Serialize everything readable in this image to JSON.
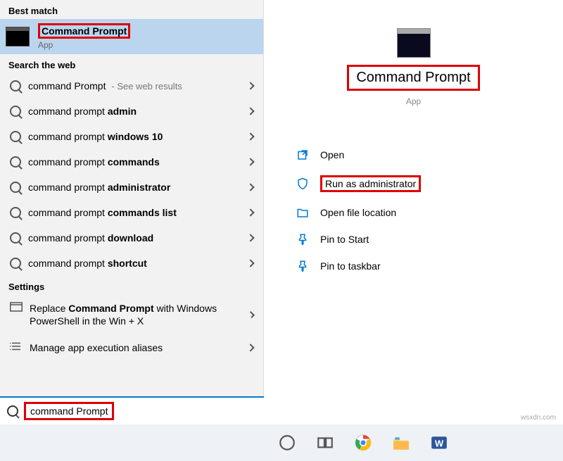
{
  "left": {
    "best_match_header": "Best match",
    "best_match": {
      "title": "Command Prompt",
      "subtitle": "App"
    },
    "web_header": "Search the web",
    "web_results": [
      {
        "prefix": "command Prompt",
        "bold": "",
        "hint": "- See web results"
      },
      {
        "prefix": "command prompt ",
        "bold": "admin",
        "hint": ""
      },
      {
        "prefix": "command prompt ",
        "bold": "windows 10",
        "hint": ""
      },
      {
        "prefix": "command prompt ",
        "bold": "commands",
        "hint": ""
      },
      {
        "prefix": "command prompt ",
        "bold": "administrator",
        "hint": ""
      },
      {
        "prefix": "command prompt ",
        "bold": "commands list",
        "hint": ""
      },
      {
        "prefix": "command prompt ",
        "bold": "download",
        "hint": ""
      },
      {
        "prefix": "command prompt ",
        "bold": "shortcut",
        "hint": ""
      }
    ],
    "settings_header": "Settings",
    "settings": [
      "Replace Command Prompt with Windows PowerShell in the Win + X",
      "Manage app execution aliases"
    ]
  },
  "right": {
    "title": "Command Prompt",
    "subtitle": "App",
    "actions": {
      "open": "Open",
      "run_admin": "Run as administrator",
      "file_loc": "Open file location",
      "pin_start": "Pin to Start",
      "pin_taskbar": "Pin to taskbar"
    }
  },
  "search": {
    "value": "command Prompt"
  },
  "watermark": "wsxdn.com"
}
